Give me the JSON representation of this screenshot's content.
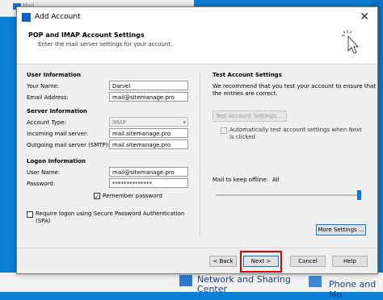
{
  "background": {
    "window_title": "Mail",
    "taskbar_items": [
      "Network and Sharing",
      "Center",
      "Phone and Mo"
    ]
  },
  "dialog": {
    "title": "Add Account",
    "close_glyph": "✕",
    "header_title": "POP and IMAP Account Settings",
    "header_subtitle": "Enter the mail server settings for your account."
  },
  "user_info": {
    "heading": "User Information",
    "name_label": "Your Name:",
    "name_value": "Daniel",
    "email_label": "Email Address:",
    "email_value": "mail@sitemanage.pro"
  },
  "server_info": {
    "heading": "Server Information",
    "account_type_label": "Account Type:",
    "account_type_value": "IMAP",
    "incoming_label": "Incoming mail server:",
    "incoming_value": "mail.sitemanage.pro",
    "outgoing_label": "Outgoing mail server (SMTP):",
    "outgoing_value": "mail.sitemanage.pro"
  },
  "logon_info": {
    "heading": "Logon Information",
    "username_label": "User Name:",
    "username_value": "mail@sitemanage.pro",
    "password_label": "Password:",
    "password_value": "**************",
    "remember_label": "Remember password",
    "spa_label_line1": "Require logon using Secure Password Authentication",
    "spa_label_line2": "(SPA)"
  },
  "test_settings": {
    "heading": "Test Account Settings",
    "desc_line1": "We recommend that you test your account to ensure that",
    "desc_line2": "the entries are correct.",
    "test_button": "Test Account Settings ...",
    "auto_test_line1": "Automatically test account settings when Next",
    "auto_test_line2": "is clicked"
  },
  "offline": {
    "label": "Mail to keep offline:",
    "value": "All",
    "level": 1.0
  },
  "buttons": {
    "more_settings": "More Settings ...",
    "back": "< Back",
    "next": "Next >",
    "cancel": "Cancel",
    "help": "Help"
  },
  "colors": {
    "accent": "#0078d7",
    "highlight": "#e00000",
    "desktop": "#0c7fd6"
  }
}
